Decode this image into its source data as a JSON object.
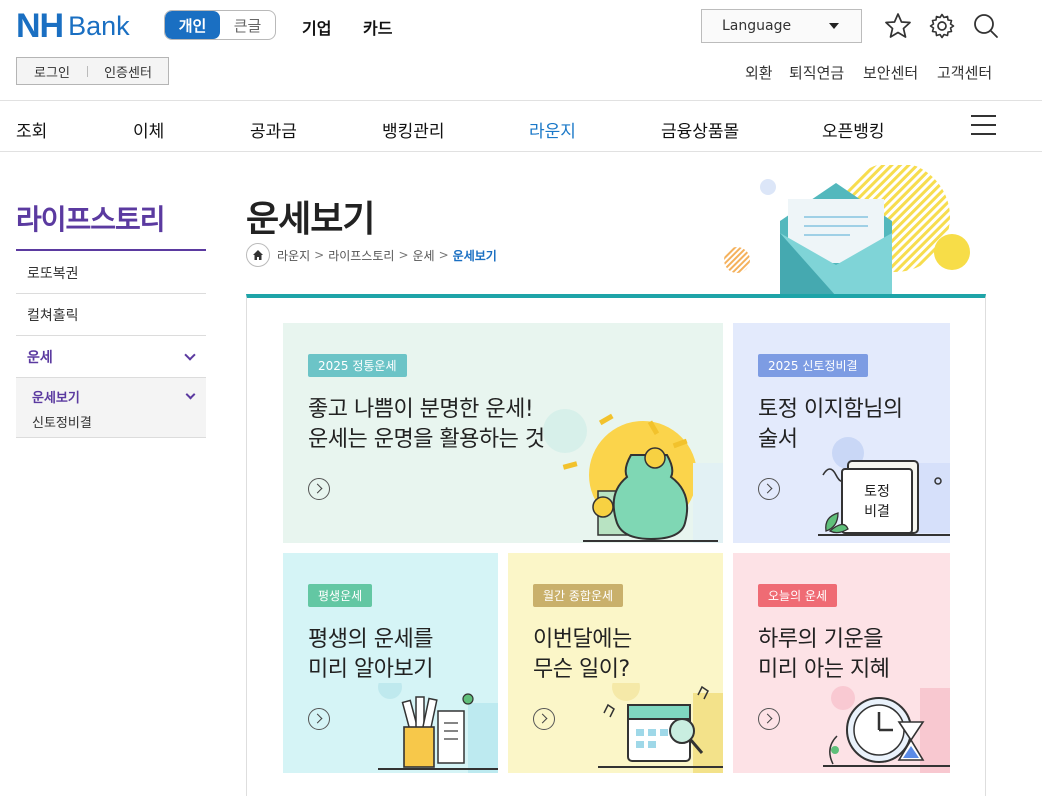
{
  "header": {
    "logo_nh": "NH",
    "logo_bank": "Bank",
    "mode_personal": "개인",
    "mode_large": "큰글",
    "link_business": "기업",
    "link_card": "카드",
    "language_label": "Language",
    "login": "로그인",
    "certificate": "인증센터",
    "util_links": [
      "외환",
      "퇴직연금",
      "보안센터",
      "고객센터"
    ]
  },
  "gnb": {
    "items": [
      "조회",
      "이체",
      "공과금",
      "뱅킹관리",
      "라운지",
      "금융상품몰",
      "오픈뱅킹"
    ],
    "active_index": 4
  },
  "lnb": {
    "title": "라이프스토리",
    "items": [
      "로또복권",
      "컬쳐홀릭",
      "운세"
    ],
    "sub_active": "운세보기",
    "sub_other": "신토정비결"
  },
  "page": {
    "title": "운세보기",
    "breadcrumb": [
      "라운지",
      "라이프스토리",
      "운세",
      "운세보기"
    ]
  },
  "cards": [
    {
      "tag": "2025 정통운세",
      "text": "좋고 나쁨이 분명한 운세!\n운세는 운명을 활용하는 것",
      "bg": "#e8f5ef",
      "tag_color": "#6cc4c7"
    },
    {
      "tag": "2025 신토정비결",
      "text": "토정 이지함님의\n술서",
      "bg": "#e3eafc",
      "tag_color": "#7d9ce3",
      "art_text_1": "토정",
      "art_text_2": "비결"
    },
    {
      "tag": "평생운세",
      "text": "평생의 운세를\n미리 알아보기",
      "bg": "#d5f4f6",
      "tag_color": "#63c7a3"
    },
    {
      "tag": "월간 종합운세",
      "text": "이번달에는\n무슨 일이?",
      "bg": "#fbf6c8",
      "tag_color": "#c9b06b"
    },
    {
      "tag": "오늘의 운세",
      "text": "하루의 기운을\n미리 아는 지혜",
      "bg": "#fde2e6",
      "tag_color": "#ef6b74"
    }
  ],
  "colors": {
    "brand_blue": "#1a6fc2",
    "lnb_purple": "#5b3aa0",
    "content_accent": "#1ea4a8"
  }
}
